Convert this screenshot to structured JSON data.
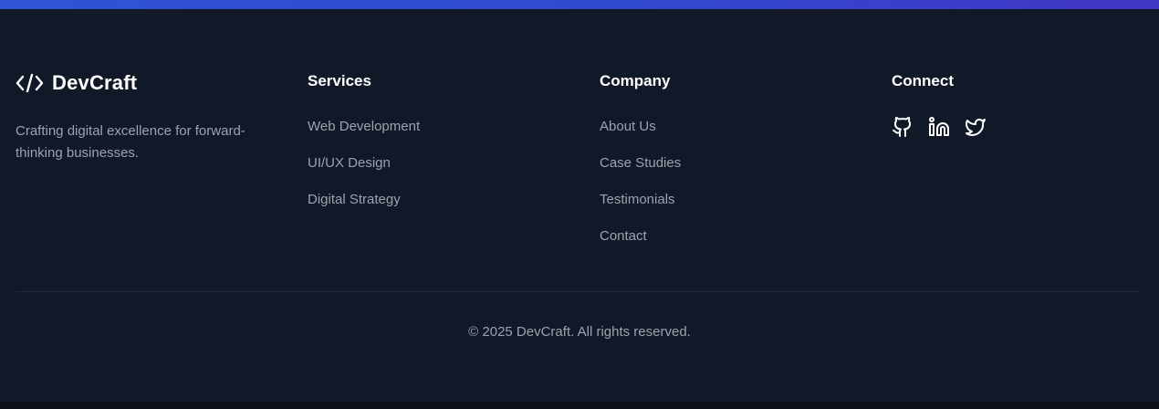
{
  "brand": {
    "icon": "code-icon",
    "name": "DevCraft",
    "tagline": "Crafting digital excellence for forward-thinking businesses."
  },
  "services": {
    "heading": "Services",
    "links": [
      "Web Development",
      "UI/UX Design",
      "Digital Strategy"
    ]
  },
  "company": {
    "heading": "Company",
    "links": [
      "About Us",
      "Case Studies",
      "Testimonials",
      "Contact"
    ]
  },
  "connect": {
    "heading": "Connect",
    "icons": [
      "github-icon",
      "linkedin-icon",
      "twitter-icon"
    ]
  },
  "footer": {
    "copyright": "© 2025 DevCraft. All rights reserved."
  },
  "colors": {
    "background": "#111827",
    "heading": "#ffffff",
    "text_muted": "#9ca3af",
    "divider": "#1f2937",
    "accent_gradient_start": "#2f54d6",
    "accent_gradient_end": "#4236c4"
  }
}
